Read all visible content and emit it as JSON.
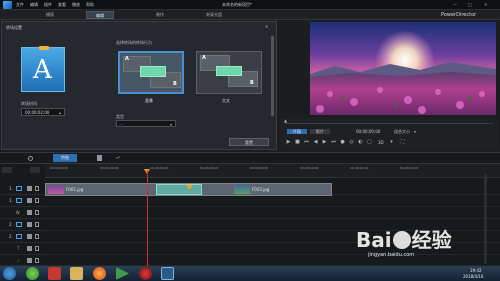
{
  "topbar": {
    "menu": [
      "文件",
      "编辑",
      "插件",
      "查看",
      "播放",
      "帮助"
    ],
    "title": "未命名的新项目*",
    "brand": "PowerDirector"
  },
  "nav_tabs": [
    "捕获",
    "编辑",
    "制作",
    "刻录光盘"
  ],
  "panel": {
    "title": "转场设置",
    "duration_label": "转场时间",
    "duration_value": "00;00;02;00",
    "behavior_label": "选择转场的转场行为",
    "option_a": {
      "name": "重叠",
      "letter_a": "A",
      "letter_b": "B"
    },
    "option_b": {
      "name": "交叉",
      "letter_a": "A",
      "letter_b": "B"
    },
    "type_label": "类型",
    "type_value": "---",
    "reset_button": "重置",
    "icon_letter": "A"
  },
  "preview": {
    "timecode_left": "00;00;00;00",
    "timecode_right": "00;00;00;00",
    "clip_button": "片段",
    "movie_button": "影片",
    "fit_label": "适合大小",
    "mode_3d": "3D"
  },
  "toolrow": {
    "fx_button": "特效"
  },
  "timeline": {
    "ruler": [
      "00;00;00;00",
      "00;00;02;00",
      "00;00;04;00",
      "00;00;06;00",
      "00;00;08;00",
      "00;00;10;00",
      "00;00;12;00",
      "00;00;14;00"
    ],
    "track_labels": [
      "1.",
      "1.",
      "fx",
      "2.",
      "2.",
      "T",
      "♪"
    ],
    "clip_labels": [
      "F001.jpg",
      "F003.jpg"
    ]
  },
  "taskbar": {
    "time": "19:42",
    "date": "2018/4/16"
  },
  "watermark": {
    "brand": "Bai",
    "suffix": "经验",
    "url": "jingyan.baidu.com"
  },
  "colors": {
    "accent": "#4a8fd6",
    "transition": "#6ed7ad",
    "playhead": "#c0392b"
  }
}
